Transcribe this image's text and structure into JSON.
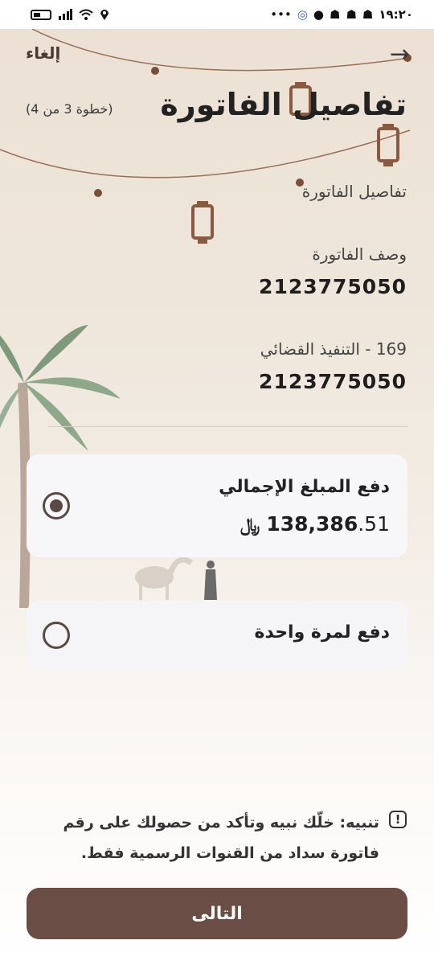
{
  "status_bar": {
    "time": "١٩:٢٠",
    "icons": [
      "battery-icon",
      "signal-icon",
      "wifi-icon",
      "location-icon",
      "more-dots-icon",
      "app-icon",
      "chat-icon",
      "snapchat-icon",
      "snapchat-icon",
      "snapchat-icon"
    ]
  },
  "header": {
    "cancel_label": "إلغاء",
    "back_icon": "arrow-right-icon",
    "title": "تفاصيل الفاتورة",
    "step": "(خطوة 3 من 4)"
  },
  "section": {
    "label": "تفاصيل الفاتورة"
  },
  "fields": [
    {
      "label": "وصف الفاتورة",
      "value": "2123775050"
    },
    {
      "label": "169 - التنفيذ القضائي",
      "value": "2123775050"
    }
  ],
  "payment_options": [
    {
      "label": "دفع المبلغ الإجمالي",
      "amount_main": "138,386",
      "amount_decimal": ".51",
      "currency": "﷼",
      "selected": true
    },
    {
      "label": "دفع لمرة واحدة",
      "selected": false
    }
  ],
  "warning": {
    "text": "تنبيه: خلّك نبيه وتأكد من حصولك على رقم فاتورة سداد من القنوات الرسمية فقط."
  },
  "footer": {
    "next_label": "التالى"
  },
  "colors": {
    "primary": "#6a4d44",
    "radio": "#5a4843",
    "card": "#f5f4f7"
  }
}
